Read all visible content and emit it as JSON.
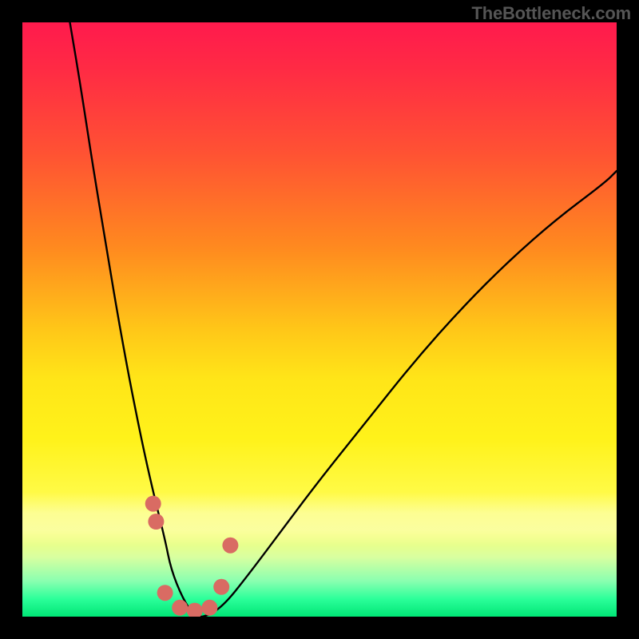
{
  "attribution": "TheBottleneck.com",
  "chart_data": {
    "type": "line",
    "title": "",
    "xlabel": "",
    "ylabel": "",
    "xlim": [
      0,
      100
    ],
    "ylim": [
      0,
      100
    ],
    "gradient_stops": [
      {
        "pos": 0,
        "color": "#ff1a4d"
      },
      {
        "pos": 22,
        "color": "#ff5233"
      },
      {
        "pos": 52,
        "color": "#ffc818"
      },
      {
        "pos": 80,
        "color": "#fffb4a"
      },
      {
        "pos": 97,
        "color": "#2cff9a"
      },
      {
        "pos": 100,
        "color": "#00e676"
      }
    ],
    "series": [
      {
        "name": "bottleneck-curve",
        "x": [
          8,
          10,
          12,
          14,
          16,
          18,
          20,
          22,
          24,
          25,
          27,
          29,
          31,
          34,
          38,
          44,
          50,
          58,
          66,
          74,
          82,
          90,
          98,
          100
        ],
        "values": [
          100,
          88,
          75,
          63,
          51,
          40,
          30,
          21,
          13,
          8,
          3,
          0,
          0,
          2,
          7,
          15,
          23,
          33,
          43,
          52,
          60,
          67,
          73,
          75
        ]
      }
    ],
    "markers": {
      "name": "highlight-dots",
      "x": [
        22.0,
        22.5,
        24.0,
        26.5,
        29.0,
        31.5,
        33.5,
        35.0
      ],
      "values": [
        19.0,
        16.0,
        4.0,
        1.5,
        1.0,
        1.5,
        5.0,
        12.0
      ],
      "radius_px": 10,
      "color": "#d96b63"
    }
  }
}
